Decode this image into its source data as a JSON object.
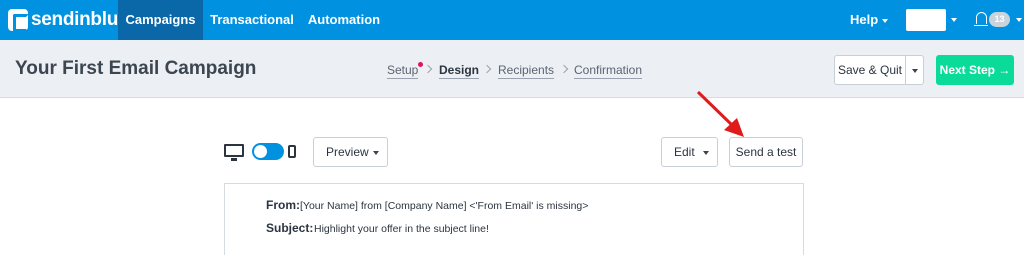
{
  "topnav": {
    "brand": "sendinblue",
    "items": [
      {
        "label": "Campaigns",
        "active": true
      },
      {
        "label": "Transactional"
      },
      {
        "label": "Automation"
      }
    ],
    "help_label": "Help",
    "notification_count": "13"
  },
  "subheader": {
    "title": "Your First Email Campaign",
    "steps": [
      {
        "label": "Setup"
      },
      {
        "label": "Design",
        "active": true
      },
      {
        "label": "Recipients"
      },
      {
        "label": "Confirmation"
      }
    ],
    "save_label": "Save & Quit",
    "next_label": "Next Step →"
  },
  "toolbar": {
    "preview_label": "Preview",
    "edit_label": "Edit",
    "send_test_label": "Send a test"
  },
  "email": {
    "from_label": "From:",
    "from_value": "[Your Name] from [Company Name] <'From Email' is missing>",
    "subject_label": "Subject:",
    "subject_value": "Highlight your offer in the subject line!"
  },
  "colors": {
    "nav_bg": "#0092e0",
    "nav_active": "#0b68a8",
    "next_button": "#0bdb98",
    "step_dot": "#e2135b",
    "annotation_arrow": "#e01b1b"
  },
  "icons": [
    "sendinblue-logo-icon",
    "bell-icon",
    "desktop-icon",
    "mobile-icon",
    "chevron-right-icon",
    "caret-down-icon",
    "arrow-right-icon"
  ]
}
